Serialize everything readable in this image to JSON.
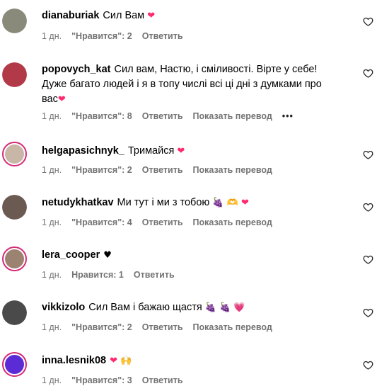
{
  "comments": [
    {
      "username": "dianaburiak",
      "text": "Сил Вам",
      "emoji": "❤",
      "time": "1 дн.",
      "likes": "\"Нравится\": 2",
      "reply": "Ответить",
      "translate": "",
      "avatar_color": "#8a8a7a",
      "story_ring": false
    },
    {
      "username": "popovych_kat",
      "text": "Сил вам, Настю, і сміливості. Вірте у себе! Дуже багато людей і я в топу числі всі ці дні з думками про вас",
      "emoji": "❤",
      "time": "1 дн.",
      "likes": "\"Нравится\": 8",
      "reply": "Ответить",
      "translate": "Показать перевод",
      "more": "•••",
      "avatar_color": "#b23a48",
      "story_ring": false
    },
    {
      "username": "helgapasichnyk_",
      "text": "Тримайся",
      "emoji": "❤",
      "time": "1 дн.",
      "likes": "\"Нравится\": 2",
      "reply": "Ответить",
      "translate": "Показать перевод",
      "avatar_color": "#c8b6a6",
      "story_ring": true
    },
    {
      "username": "netudykhatkav",
      "text": "Ми тут і ми з тобою",
      "emoji": "🍇 🫶 ❤",
      "time": "1 дн.",
      "likes": "\"Нравится\": 4",
      "reply": "Ответить",
      "translate": "Показать перевод",
      "avatar_color": "#6b5a52",
      "story_ring": false
    },
    {
      "username": "lera_cooper",
      "text": "",
      "emoji": "♥",
      "time": "1 дн.",
      "likes": "Нравится: 1",
      "reply": "Ответить",
      "translate": "",
      "avatar_color": "#9c8270",
      "story_ring": true
    },
    {
      "username": "vikkizolo",
      "text": "Сил Вам і бажаю щастя",
      "emoji": "🍇 🍇 💗",
      "time": "1 дн.",
      "likes": "\"Нравится\": 2",
      "reply": "Ответить",
      "translate": "Показать перевод",
      "avatar_color": "#4a4a4a",
      "story_ring": false
    },
    {
      "username": "inna.lesnik08",
      "text": "",
      "emoji": "❤ 🙌",
      "time": "1 дн.",
      "likes": "\"Нравится\": 3",
      "reply": "Ответить",
      "translate": "",
      "avatar_color": "#5b2bd6",
      "story_ring": true
    }
  ]
}
